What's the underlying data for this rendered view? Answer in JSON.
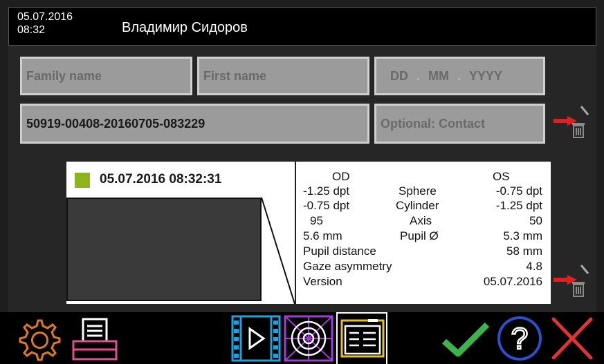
{
  "header": {
    "date": "05.07.2016",
    "time": "08:32",
    "user_name": "Владимир Сидоров"
  },
  "form": {
    "family_name_placeholder": "Family name",
    "first_name_placeholder": "First name",
    "dob_day_placeholder": "DD",
    "dob_month_placeholder": "MM",
    "dob_year_placeholder": "YYYY",
    "patient_id": "50919-00408-20160705-083229",
    "contact_placeholder": "Optional: Contact"
  },
  "record": {
    "timestamp": "05.07.2016 08:32:31",
    "status_color": "#8db31d",
    "od_label": "OD",
    "os_label": "OS",
    "sphere_label": "Sphere",
    "sphere_od": "-1.25  dpt",
    "sphere_os": "-0.75  dpt",
    "cylinder_label": "Cylinder",
    "cylinder_od": "-0.75  dpt",
    "cylinder_os": "-1.25  dpt",
    "axis_label": "Axis",
    "axis_od": "95",
    "axis_os": "50",
    "pupil_label": "Pupil Ø",
    "pupil_od": "5.6  mm",
    "pupil_os": "5.3 mm",
    "pupil_distance_label": "Pupil distance",
    "pupil_distance": "58 mm",
    "gaze_asymmetry_label": "Gaze asymmetry",
    "gaze_asymmetry": "4.8",
    "version_label": "Version",
    "version": "05.07.2016"
  },
  "toolbar": {
    "icons": [
      "gear-icon",
      "printer-icon",
      "video-icon",
      "target-icon",
      "report-icon",
      "check-icon",
      "help-icon",
      "close-icon"
    ],
    "colors": {
      "gear": "#e07a1f",
      "printer": "#e04f8f",
      "video": "#1aa3e0",
      "target": "#a43ad8",
      "report": "#e8c21a",
      "check": "#3bb54a",
      "help": "#2c4fd0",
      "close": "#e03333"
    }
  }
}
